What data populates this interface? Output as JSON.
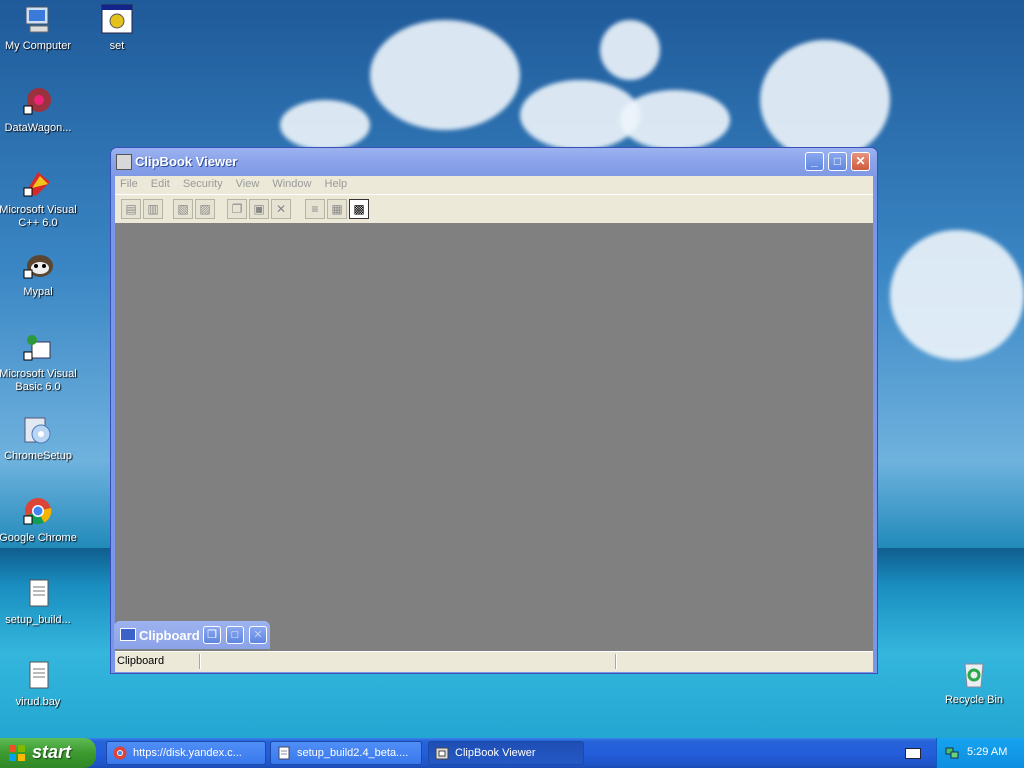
{
  "desktop": {
    "icons": [
      {
        "label": "My Computer",
        "icon": "computer-icon"
      },
      {
        "label": "set",
        "icon": "setup-exe-icon"
      },
      {
        "label": "DataWagon...",
        "icon": "datawagon-icon"
      },
      {
        "label": "Microsoft Visual C++ 6.0",
        "icon": "visual-cpp-icon"
      },
      {
        "label": "Mypal",
        "icon": "mypal-browser-icon"
      },
      {
        "label": "Microsoft Visual Basic 6.0",
        "icon": "visual-basic-icon"
      },
      {
        "label": "ChromeSetup",
        "icon": "chrome-setup-icon"
      },
      {
        "label": "Google Chrome",
        "icon": "chrome-icon"
      },
      {
        "label": "setup_build...",
        "icon": "text-file-icon"
      },
      {
        "label": "virud.bay",
        "icon": "text-file-icon"
      },
      {
        "label": "Recycle Bin",
        "icon": "recycle-bin-icon"
      }
    ]
  },
  "window": {
    "title": "ClipBook Viewer",
    "menu": [
      "File",
      "Edit",
      "Security",
      "View",
      "Window",
      "Help"
    ],
    "child": {
      "title": "Clipboard"
    },
    "status": {
      "text": "Clipboard"
    }
  },
  "taskbar": {
    "start_label": "start",
    "tasks": [
      {
        "label": "https://disk.yandex.c...",
        "icon": "chrome-icon"
      },
      {
        "label": "setup_build2.4_beta....",
        "icon": "notepad-icon"
      },
      {
        "label": "ClipBook Viewer",
        "icon": "clipbook-icon"
      }
    ],
    "clock": "5:29 AM"
  },
  "colors": {
    "accent": "#7996e8",
    "taskbar": "#245edb",
    "start": "#3c9a2f"
  }
}
